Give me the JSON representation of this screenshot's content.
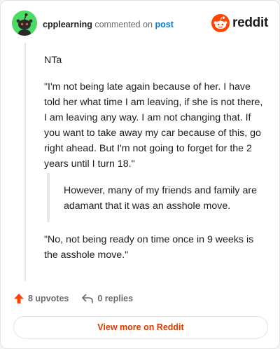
{
  "comment": {
    "username": "cpplearning",
    "action_text": "commented on",
    "target_link": "post",
    "avatar_color": "#4cd964"
  },
  "brand": {
    "name": "reddit",
    "accent": "#ff4500",
    "icon": "reddit-snoo-icon"
  },
  "body": {
    "paragraphs": [
      "NTa",
      "\"I'm not being late again because of her. I have told her what time I am leaving, if she is not there, I am leaving any way. I am not changing that. If you want to take away my car because of this, go right ahead. But I'm not going to forget for the 2 years until I turn 18.\"",
      "\"No, not being ready on time once in 9 weeks is the asshole move.\""
    ],
    "quote": "However, many of my friends and family are adamant that it was an asshole move."
  },
  "footer": {
    "upvotes_label": "8 upvotes",
    "upvote_icon": "upvote-arrow-icon",
    "upvote_color": "#ff4500",
    "replies_label": "0 replies",
    "reply_icon": "reply-arrow-icon"
  },
  "actions": {
    "view_more_label": "View more on Reddit"
  }
}
